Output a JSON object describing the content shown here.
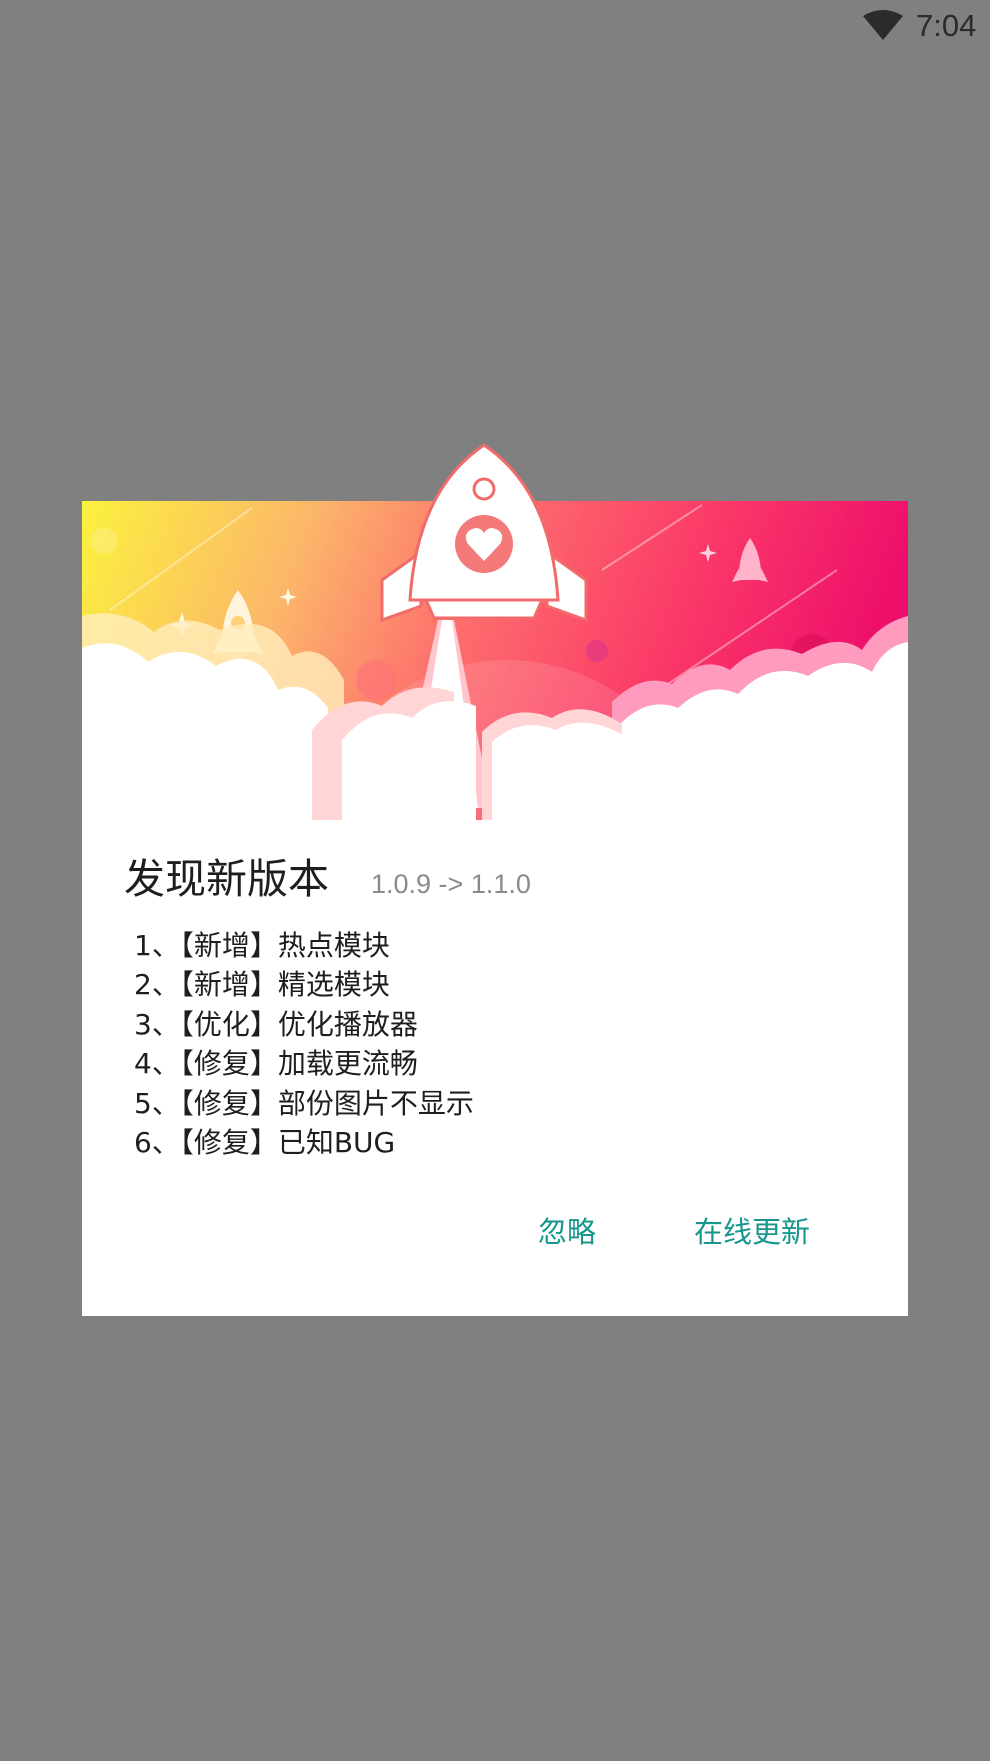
{
  "status_bar": {
    "time": "7:04",
    "wifi_icon": "wifi-icon"
  },
  "dialog": {
    "title": "发现新版本",
    "version": "1.0.9 -> 1.1.0",
    "changelog": [
      "1、【新增】热点模块",
      "2、【新增】精选模块",
      "3、【优化】优化播放器",
      "4、【修复】加载更流畅",
      "5、【修复】部份图片不显示",
      "6、【修复】已知BUG"
    ],
    "buttons": {
      "ignore": "忽略",
      "update": "在线更新"
    },
    "accent_color": "#16968c",
    "header_icon": "rocket-icon"
  }
}
